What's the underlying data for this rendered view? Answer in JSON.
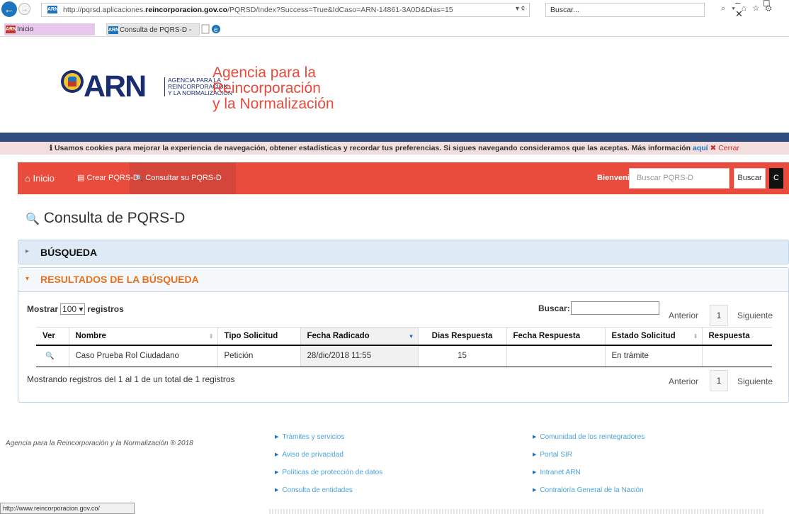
{
  "browser": {
    "url_prefix": "http://pqrsd.aplicaciones.",
    "url_domain": "reincorporacion.gov.co",
    "url_rest": "/PQRSD/Index?Success=True&IdCaso=ARN-14861-3A0D&Dias=15",
    "addr_controls": "▾ ¢",
    "search_placeholder": "Buscar...",
    "search_controls": "⌕ ▾  ⌂ ☆ ⚙",
    "window_controls": "– ◻ ✕",
    "tab_home": "Inicio",
    "tab_active": "Consulta de PQRS-D - PQR...",
    "tab_close": "✕",
    "favicon_text": "ARN",
    "status_url": "http://www.reincorporacion.gov.co/"
  },
  "header": {
    "logo_text": "ARN",
    "logo_sub1": "AGENCIA PARA LA",
    "logo_sub2": "REINCORPORACIÓN",
    "logo_sub3": "Y LA NORMALIZACIÓN",
    "brand1": "Agencia para la",
    "brand2": "Reincorporación",
    "brand3": "y la Normalización"
  },
  "cookie": {
    "icon": "ℹ",
    "text": "Usamos cookies para mejorar la experiencia de navegación, obtener estadísticas y recordar tus preferencias. Si sigues navegando consideramos que las aceptas. Más información",
    "link": "aquí",
    "close_icon": "✖",
    "close": "Cerrar"
  },
  "nav": {
    "home_icon": "⌂",
    "home": "Inicio",
    "create_icon": "▤",
    "create": "Crear PQRS-D",
    "consult_icon": "🔍",
    "consult": "Consultar su PQRS-D",
    "welcome": "Bienvenido",
    "search_placeholder": "Buscar PQRS-D",
    "search_button": "Buscar",
    "extra_button": "C"
  },
  "page": {
    "title_icon": "🔍",
    "title": "Consulta de PQRS-D",
    "section_search": "BÚSQUEDA",
    "section_results": "RESULTADOS DE LA BÚSQUEDA",
    "caret_closed": "▸",
    "caret_open": "▾"
  },
  "results": {
    "show_label": "Mostrar",
    "show_value": "100 ▾",
    "show_suffix": "registros",
    "search_label": "Buscar:",
    "prev": "Anterior",
    "page": "1",
    "next": "Siguiente",
    "info": "Mostrando registros del 1 al 1 de un total de 1 registros",
    "columns": [
      "Ver",
      "Nombre",
      "Tipo Solicitud",
      "Fecha Radicado",
      "Dias Respuesta",
      "Fecha Respuesta",
      "Estado Solicitud",
      "Respuesta"
    ],
    "sort_icon": "⬍",
    "sort_active_icon": "▼",
    "row": {
      "ver_icon": "🔍",
      "nombre": "Caso Prueba Rol Ciudadano",
      "tipo": "Petición",
      "fecha_radicado": "28/dic/2018 11:55",
      "dias": "15",
      "fecha_respuesta": "",
      "estado": "En trámite",
      "respuesta": ""
    }
  },
  "footer": {
    "copyright": "Agencia para la Reincorporación y la Normalización ® 2018",
    "links_col1": [
      "Trámites y servicios",
      "Aviso de privacidad",
      "Políticas de protección de datos",
      "Consulta de entidades"
    ],
    "links_col2": [
      "Comunidad de los reintegradores",
      "Portal SIR",
      "Intranet ARN",
      "Contraloría General de la Nación"
    ]
  },
  "colors": {
    "brand_red": "#e94b3c",
    "brand_navy": "#1a2d6f",
    "accent_orange": "#e8701d",
    "link_blue": "#1e73be"
  }
}
